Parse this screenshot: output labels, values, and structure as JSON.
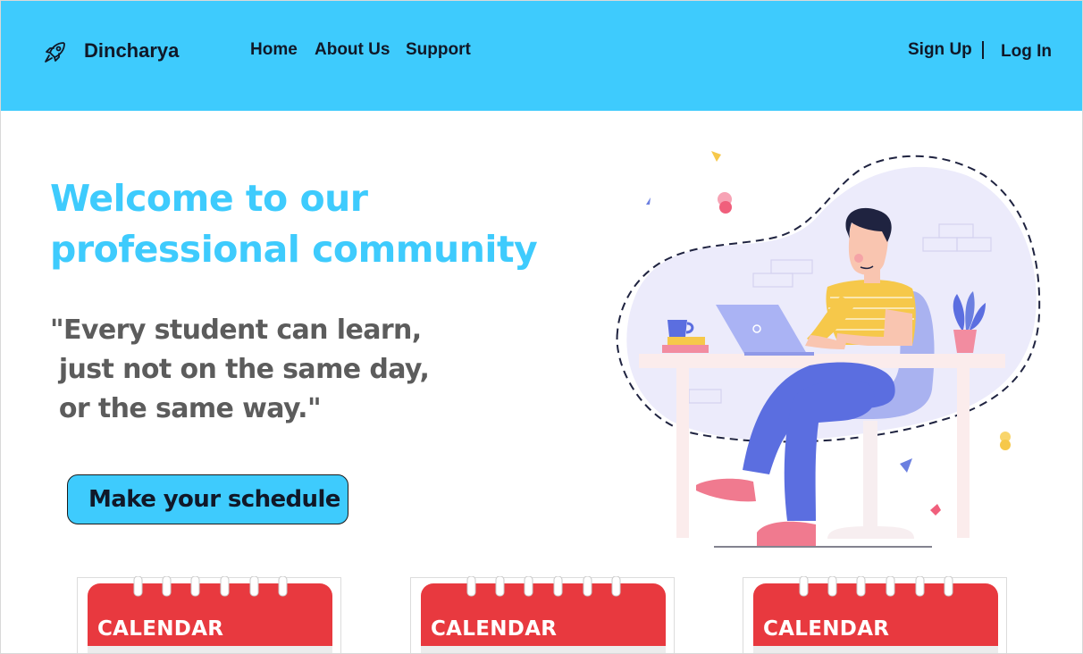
{
  "header": {
    "brand": "Dincharya",
    "logo_icon": "rocket-icon",
    "nav": {
      "home": "Home",
      "about": "About Us",
      "support": "Support"
    },
    "auth": {
      "signup": "Sign Up",
      "login": "Log In"
    },
    "background": "#3ecbfd"
  },
  "hero": {
    "title_line1": "Welcome to our",
    "title_line2": "professional community",
    "quote_lines": [
      "\"Every student can learn,",
      " just not on the same day,",
      " or the same way.\""
    ],
    "cta_label": "Make your schedule",
    "accent_color": "#3ecbfd"
  },
  "illustration": {
    "icon": "person-working-on-laptop-illustration"
  },
  "cards": [
    {
      "label": "CALENDAR",
      "icon": "calendar-icon"
    },
    {
      "label": "CALENDAR",
      "icon": "calendar-icon"
    },
    {
      "label": "CALENDAR",
      "icon": "calendar-icon"
    }
  ]
}
